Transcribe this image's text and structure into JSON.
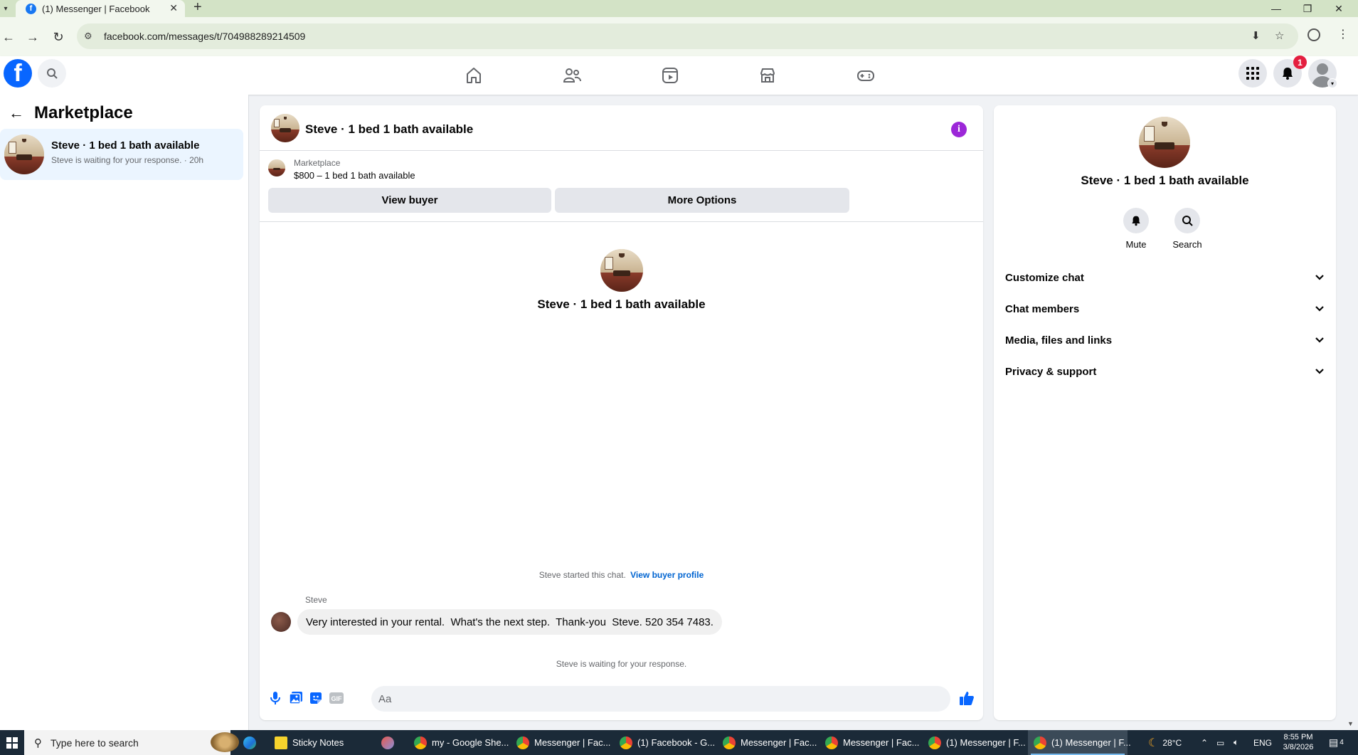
{
  "browser": {
    "tab_title": "(1) Messenger | Facebook",
    "tab_close": "✕",
    "new_tab": "+",
    "url": "facebook.com/messages/t/704988289214509"
  },
  "fb": {
    "logo_letter": "f",
    "notification_count": "1"
  },
  "left_panel": {
    "title": "Marketplace",
    "conversation": {
      "name": "Steve · 1 bed 1 bath available",
      "preview": "Steve is waiting for your response. · 20h"
    }
  },
  "chat": {
    "header_name": "Steve · 1 bed 1 bath available",
    "marketplace_label": "Marketplace",
    "listing": "$800 – 1 bed 1 bath available",
    "view_buyer_label": "View buyer",
    "more_options_label": "More Options",
    "intro_name": "Steve · 1 bed 1 bath available",
    "started_text": "Steve started this chat.",
    "view_buyer_profile_link": "View buyer profile",
    "sender_name": "Steve",
    "message": "Very interested in your rental.  What's the next step.  Thank-you  Steve. 520 354 7483.",
    "waiting_text": "Steve is waiting for your response.",
    "composer_placeholder": "Aa",
    "composer_value": ""
  },
  "right_panel": {
    "name": "Steve · 1 bed 1 bath available",
    "mute_label": "Mute",
    "search_label": "Search",
    "sections": [
      {
        "label": "Customize chat"
      },
      {
        "label": "Chat members"
      },
      {
        "label": "Media, files and links"
      },
      {
        "label": "Privacy & support"
      }
    ]
  },
  "taskbar": {
    "search_placeholder": "Type here to search",
    "items": [
      {
        "label": "Sticky Notes",
        "icon": "sticky-notes-icon"
      },
      {
        "label": "my - Google She...",
        "icon": "chrome-icon"
      },
      {
        "label": "Messenger | Fac...",
        "icon": "chrome-icon"
      },
      {
        "label": "(1) Facebook - G...",
        "icon": "chrome-icon"
      },
      {
        "label": "Messenger | Fac...",
        "icon": "chrome-icon"
      },
      {
        "label": "Messenger | Fac...",
        "icon": "chrome-icon"
      },
      {
        "label": "(1) Messenger | F...",
        "icon": "chrome-icon"
      },
      {
        "label": "(1) Messenger | F...",
        "icon": "chrome-icon"
      }
    ],
    "temperature": "28°C",
    "language": "ENG",
    "time": "8:55 PM",
    "date": "3/8/2026",
    "notification_count": "4"
  },
  "colors": {
    "fb_blue": "#0866ff",
    "info_purple": "#9c27d8",
    "link_blue": "#0064d1",
    "badge_red": "#e41e3f",
    "selected_conv_bg": "#ebf5ff"
  }
}
